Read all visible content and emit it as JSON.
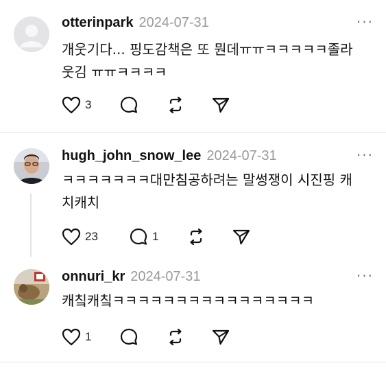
{
  "posts": [
    {
      "username": "otterinpark",
      "date": "2024-07-31",
      "text": "개웃기다... 핑도감책은 또 뭔데ㅠㅠㅋㅋㅋㅋㅋ졸라\n웃김 ㅠㅠㅋㅋㅋㅋ",
      "like_count": "3",
      "reply_count": ""
    },
    {
      "username": "hugh_john_snow_lee",
      "date": "2024-07-31",
      "text": "ㅋㅋㅋㅋㅋㅋㅋ대만침공하려는 말썽쟁이 시진핑 캐\n치캐치",
      "like_count": "23",
      "reply_count": "1"
    },
    {
      "username": "onnuri_kr",
      "date": "2024-07-31",
      "text": "캐칰캐칰ㅋㅋㅋㅋㅋㅋㅋㅋㅋㅋㅋㅋㅋㅋㅋㅋ",
      "like_count": "1",
      "reply_count": ""
    }
  ],
  "icons": {
    "more": "more-icon",
    "like": "heart-icon",
    "reply": "comment-icon",
    "repost": "repost-icon",
    "share": "share-icon"
  },
  "more_glyph": "···"
}
